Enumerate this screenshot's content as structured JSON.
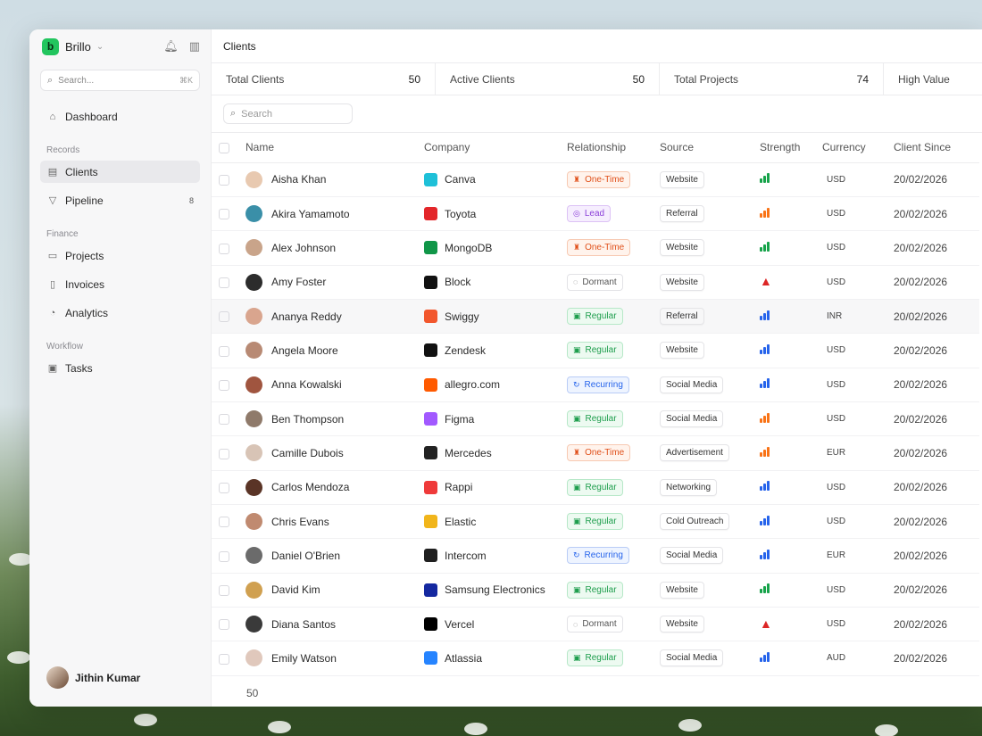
{
  "app": {
    "brand": "Brillo",
    "page_title": "Clients"
  },
  "colors": {
    "accent_green": "#22c55e",
    "danger": "#dc2626"
  },
  "sidebar": {
    "search_placeholder": "Search...",
    "search_shortcut": "⌘K",
    "dashboard": "Dashboard",
    "sections": {
      "records": "Records",
      "finance": "Finance",
      "workflow": "Workflow"
    },
    "items": {
      "clients": "Clients",
      "pipeline": "Pipeline",
      "pipeline_count": "8",
      "projects": "Projects",
      "invoices": "Invoices",
      "analytics": "Analytics",
      "tasks": "Tasks"
    },
    "user_name": "Jithin Kumar"
  },
  "stats": [
    {
      "label": "Total Clients",
      "value": "50"
    },
    {
      "label": "Active Clients",
      "value": "50"
    },
    {
      "label": "Total Projects",
      "value": "74"
    },
    {
      "label": "High Value",
      "value": ""
    }
  ],
  "table": {
    "search_placeholder": "Search",
    "columns": [
      "Name",
      "Company",
      "Relationship",
      "Source",
      "Strength",
      "Currency",
      "Client Since"
    ],
    "rows": [
      {
        "name": "Aisha Khan",
        "company": "Canva",
        "relationship": "One-Time",
        "source": "Website",
        "strength": "green",
        "currency": "USD",
        "since": "20/02/2026"
      },
      {
        "name": "Akira Yamamoto",
        "company": "Toyota",
        "relationship": "Lead",
        "source": "Referral",
        "strength": "orange",
        "currency": "USD",
        "since": "20/02/2026"
      },
      {
        "name": "Alex Johnson",
        "company": "MongoDB",
        "relationship": "One-Time",
        "source": "Website",
        "strength": "green",
        "currency": "USD",
        "since": "20/02/2026"
      },
      {
        "name": "Amy Foster",
        "company": "Block",
        "relationship": "Dormant",
        "source": "Website",
        "strength": "warn",
        "currency": "USD",
        "since": "20/02/2026"
      },
      {
        "name": "Ananya Reddy",
        "company": "Swiggy",
        "relationship": "Regular",
        "source": "Referral",
        "strength": "blue",
        "currency": "INR",
        "since": "20/02/2026"
      },
      {
        "name": "Angela Moore",
        "company": "Zendesk",
        "relationship": "Regular",
        "source": "Website",
        "strength": "blue",
        "currency": "USD",
        "since": "20/02/2026"
      },
      {
        "name": "Anna Kowalski",
        "company": "allegro.com",
        "relationship": "Recurring",
        "source": "Social Media",
        "strength": "blue",
        "currency": "USD",
        "since": "20/02/2026"
      },
      {
        "name": "Ben Thompson",
        "company": "Figma",
        "relationship": "Regular",
        "source": "Social Media",
        "strength": "orange",
        "currency": "USD",
        "since": "20/02/2026"
      },
      {
        "name": "Camille Dubois",
        "company": "Mercedes",
        "relationship": "One-Time",
        "source": "Advertisement",
        "strength": "orange",
        "currency": "EUR",
        "since": "20/02/2026"
      },
      {
        "name": "Carlos Mendoza",
        "company": "Rappi",
        "relationship": "Regular",
        "source": "Networking",
        "strength": "blue",
        "currency": "USD",
        "since": "20/02/2026"
      },
      {
        "name": "Chris Evans",
        "company": "Elastic",
        "relationship": "Regular",
        "source": "Cold Outreach",
        "strength": "blue",
        "currency": "USD",
        "since": "20/02/2026"
      },
      {
        "name": "Daniel O'Brien",
        "company": "Intercom",
        "relationship": "Recurring",
        "source": "Social Media",
        "strength": "blue",
        "currency": "EUR",
        "since": "20/02/2026"
      },
      {
        "name": "David Kim",
        "company": "Samsung Electronics",
        "relationship": "Regular",
        "source": "Website",
        "strength": "green",
        "currency": "USD",
        "since": "20/02/2026"
      },
      {
        "name": "Diana Santos",
        "company": "Vercel",
        "relationship": "Dormant",
        "source": "Website",
        "strength": "warn",
        "currency": "USD",
        "since": "20/02/2026"
      },
      {
        "name": "Emily Watson",
        "company": "Atlassia",
        "relationship": "Regular",
        "source": "Social Media",
        "strength": "blue",
        "currency": "AUD",
        "since": "20/02/2026"
      }
    ],
    "footer_count": "50"
  }
}
